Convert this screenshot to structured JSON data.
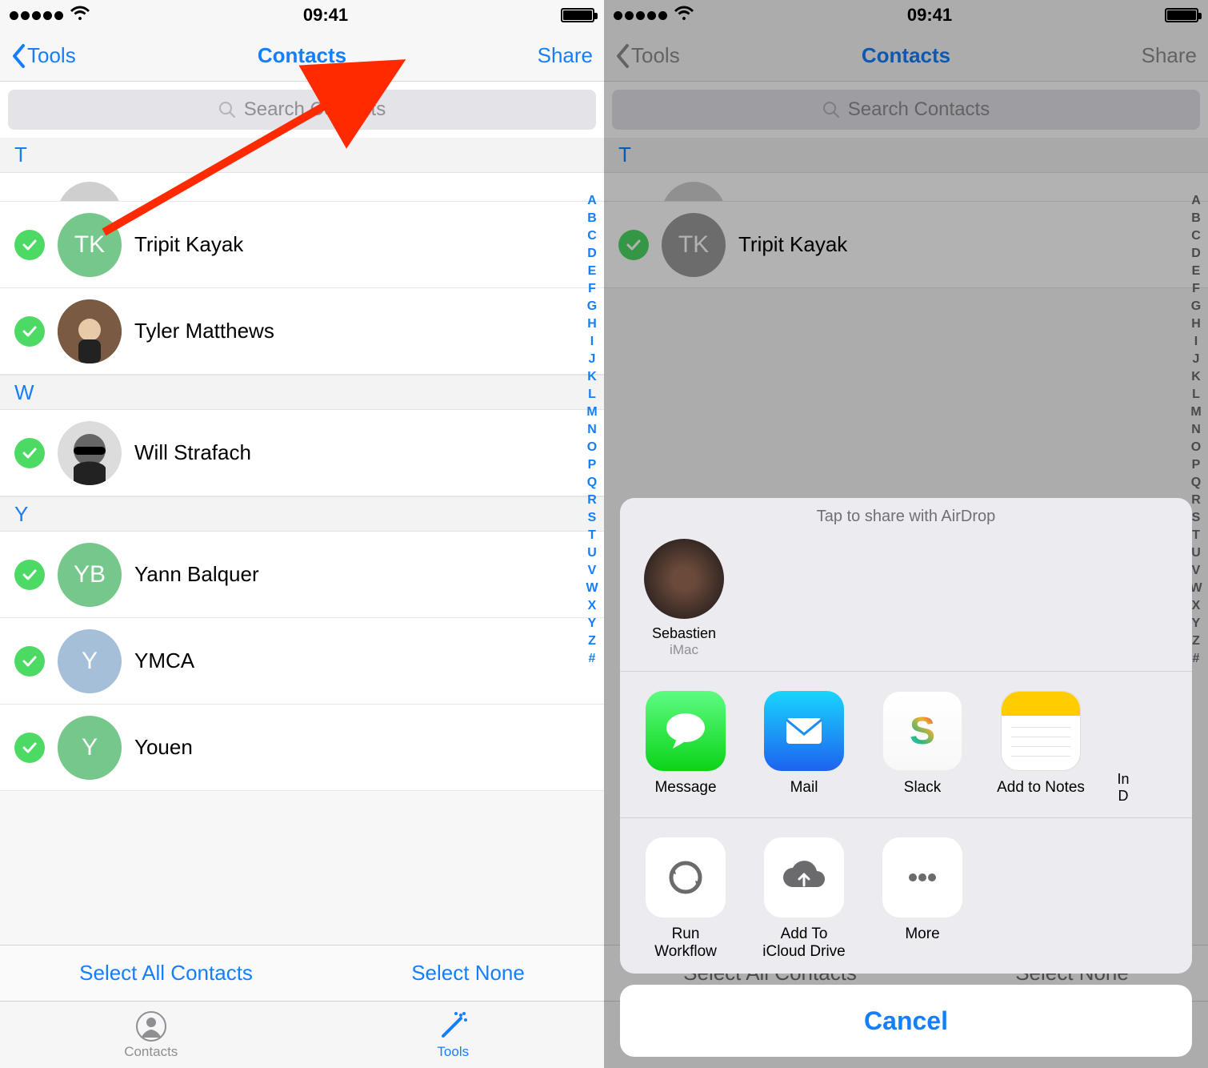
{
  "statusbar": {
    "time": "09:41"
  },
  "nav": {
    "back_label": "Tools",
    "title": "Contacts",
    "share_label": "Share"
  },
  "search": {
    "placeholder": "Search Contacts"
  },
  "sections": {
    "T": "T",
    "W": "W",
    "Y": "Y"
  },
  "contacts": {
    "tk": {
      "initials": "TK",
      "name": "Tripit Kayak"
    },
    "tm": {
      "name": "Tyler Matthews"
    },
    "ws": {
      "name": "Will Strafach"
    },
    "yb": {
      "initials": "YB",
      "name": "Yann Balquer"
    },
    "ymca": {
      "initials": "Y",
      "name": "YMCA"
    },
    "youen": {
      "initials": "Y",
      "name": "Youen"
    }
  },
  "index_bar": [
    "A",
    "B",
    "C",
    "D",
    "E",
    "F",
    "G",
    "H",
    "I",
    "J",
    "K",
    "L",
    "M",
    "N",
    "O",
    "P",
    "Q",
    "R",
    "S",
    "T",
    "U",
    "V",
    "W",
    "X",
    "Y",
    "Z",
    "#"
  ],
  "select_bar": {
    "all": "Select All Contacts",
    "none": "Select None"
  },
  "tabs": {
    "contacts": "Contacts",
    "tools": "Tools"
  },
  "share_sheet": {
    "airdrop_title": "Tap to share with AirDrop",
    "airdrop_target": {
      "name": "Sebastien",
      "device": "iMac"
    },
    "apps": [
      {
        "label": "Message"
      },
      {
        "label": "Mail"
      },
      {
        "label": "Slack"
      },
      {
        "label": "Add to Notes"
      }
    ],
    "peek_lines": [
      "In",
      "D"
    ],
    "actions": [
      {
        "label_top": "Run",
        "label_bottom": "Workflow"
      },
      {
        "label_top": "Add To",
        "label_bottom": "iCloud Drive"
      },
      {
        "label_top": "More",
        "label_bottom": ""
      }
    ],
    "cancel": "Cancel"
  }
}
